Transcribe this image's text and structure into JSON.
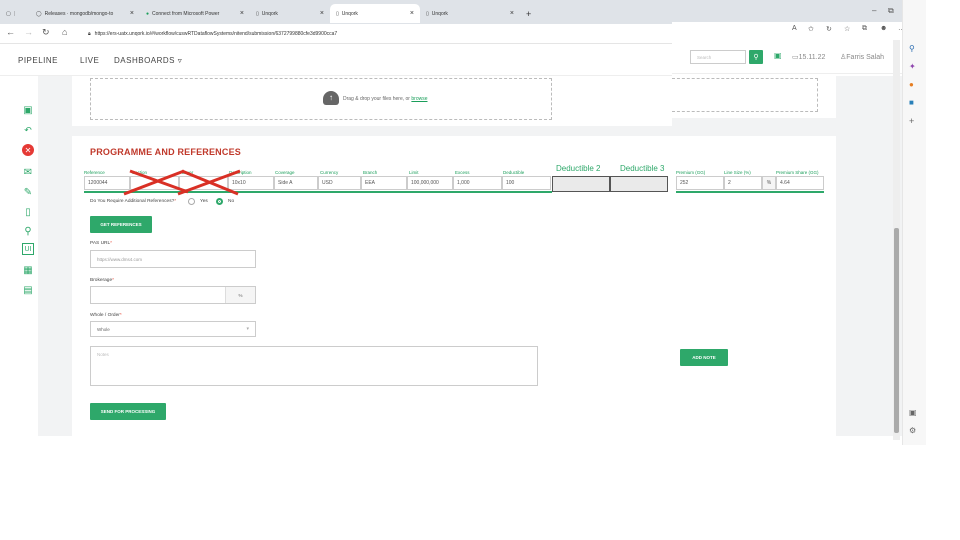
{
  "browser": {
    "tabs": [
      {
        "label": "Releases · mongodb/mongo-to"
      },
      {
        "label": "Connect from Microsoft Power"
      },
      {
        "label": "Unqork"
      },
      {
        "label": "Unqork"
      },
      {
        "label": "Unqork"
      }
    ],
    "url": "https://ers-uatx.unqork.io/#/workflow/cuswRTDataflowSystems/nitend/submission/6372799880cfe3d9900cca7"
  },
  "nav": {
    "items": [
      "PIPELINE",
      "LIVE",
      "DASHBOARDS ▿"
    ],
    "search_placeholder": "Search",
    "date": "15.11.22",
    "user": "Farris Salah"
  },
  "upload": {
    "text": "Drag & drop your files here, or",
    "link": "browse"
  },
  "programme": {
    "title": "PROGRAMME AND REFERENCES",
    "columns": [
      "Reference",
      "Section",
      "Layer",
      "Description",
      "Coverage",
      "Currency",
      "Branch",
      "Limit",
      "Excess",
      "Deductible"
    ],
    "values": [
      "1200044",
      "",
      "",
      "10x10",
      "Side A",
      "USD",
      "EEA",
      "100,000,000",
      "1,000",
      "100"
    ],
    "extra_headers": [
      "Deductible 2",
      "Deductible 3"
    ],
    "right_columns": [
      "Premium (GG)",
      "Line Size (%)",
      "Premium Share (GG)"
    ],
    "right_values": [
      "252",
      "2",
      "4.64"
    ],
    "percent": "%"
  },
  "form": {
    "require_refs_label": "Do You Require Additional References?",
    "yes": "Yes",
    "no": "No",
    "get_refs_button": "GET REFERENCES",
    "pas_url_label": "PAS URL",
    "pas_url_placeholder": "https://www.dms4.com",
    "brokerage_label": "Brokerage",
    "brokerage_suffix": "%",
    "whole_order_label": "Whole / Order",
    "whole_order_value": "Whole",
    "notes_placeholder": "Notes",
    "add_note_button": "ADD NOTE",
    "send_button": "SEND FOR PROCESSING"
  },
  "colors": {
    "accent": "#2ea86a",
    "title_red": "#c0392b",
    "cross_red": "#d93025"
  }
}
